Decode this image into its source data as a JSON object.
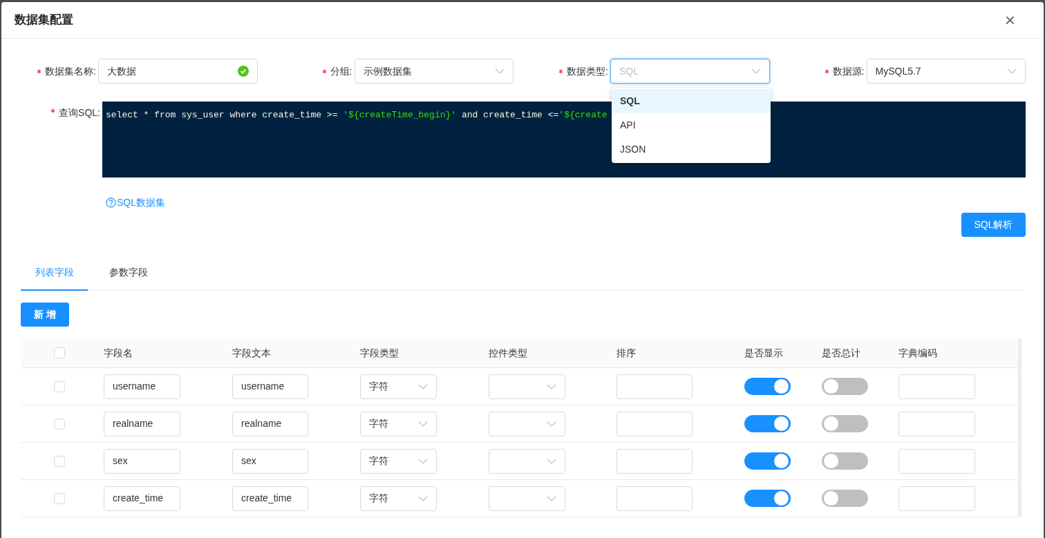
{
  "dialog": {
    "title": "数据集配置",
    "close": "×"
  },
  "form": [
    {
      "label": "数据集名称:",
      "required": true,
      "kind": "input",
      "value": "大数据",
      "valid": true
    },
    {
      "label": "分组:",
      "required": true,
      "kind": "select",
      "value": "示例数据集",
      "focused": false
    },
    {
      "label": "数据类型:",
      "required": true,
      "kind": "select",
      "placeholder": "SQL",
      "focused": true
    },
    {
      "label": "数据源:",
      "required": true,
      "kind": "select",
      "value": "MySQL5.7",
      "focused": false
    }
  ],
  "sql": {
    "label": "查询SQL:",
    "required": true,
    "tokens": [
      {
        "kind": "code",
        "text": "select * from sys_user where create_time >= "
      },
      {
        "kind": "string",
        "text": "'${createTime_begin}'"
      },
      {
        "kind": "code",
        "text": " and create_time <="
      },
      {
        "kind": "string",
        "text": "'${create"
      }
    ]
  },
  "dropdown": {
    "options": [
      {
        "label": "SQL",
        "selected": true
      },
      {
        "label": "API",
        "selected": false
      },
      {
        "label": "JSON",
        "selected": false
      }
    ]
  },
  "help_link": "SQL数据集",
  "parse_button": "SQL解析",
  "tabs": [
    {
      "label": "列表字段",
      "selected": true
    },
    {
      "label": "参数字段",
      "selected": false
    }
  ],
  "add_button": "新 增",
  "table": {
    "all_checked": false,
    "columns": [
      "字段名",
      "字段文本",
      "字段类型",
      "控件类型",
      "排序",
      "是否显示",
      "是否总计",
      "字典编码"
    ],
    "rows": [
      {
        "checked": false,
        "name": "username",
        "text": "username",
        "type": "字符",
        "show": true,
        "total": false
      },
      {
        "checked": false,
        "name": "realname",
        "text": "realname",
        "type": "字符",
        "show": true,
        "total": false
      },
      {
        "checked": false,
        "name": "sex",
        "text": "sex",
        "type": "字符",
        "show": true,
        "total": false
      },
      {
        "checked": false,
        "name": "create_time",
        "text": "create_time",
        "type": "字符",
        "show": true,
        "total": false
      }
    ]
  }
}
